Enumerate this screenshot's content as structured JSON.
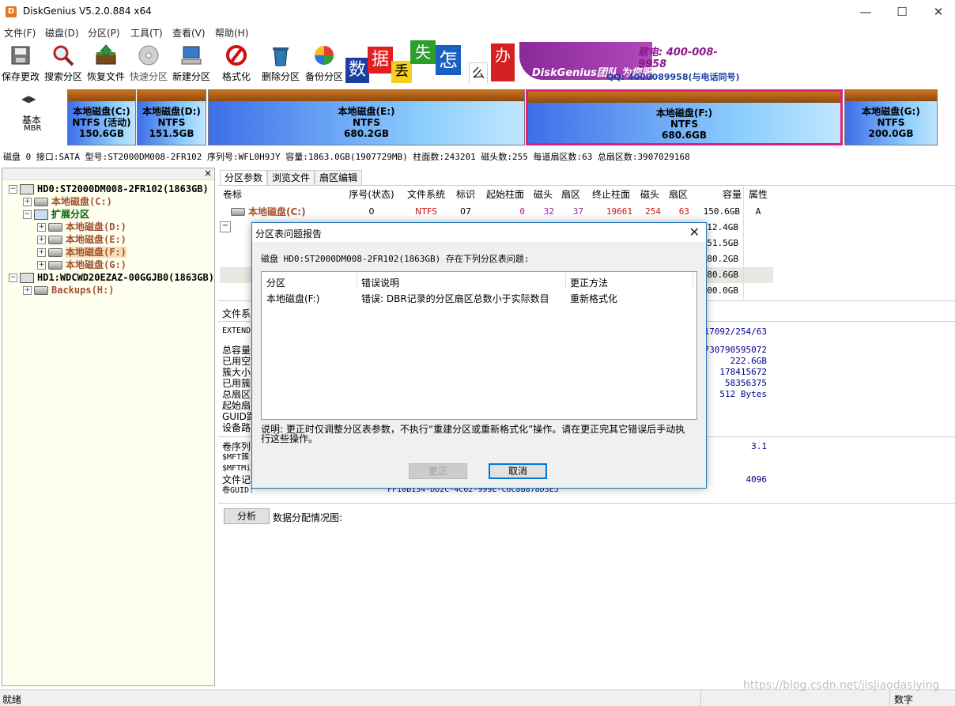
{
  "window": {
    "title": "DiskGenius V5.2.0.884 x64",
    "app_icon_letter": "D"
  },
  "menu": [
    "文件(F)",
    "磁盘(D)",
    "分区(P)",
    "工具(T)",
    "查看(V)",
    "帮助(H)"
  ],
  "toolbar": [
    {
      "label": "保存更改",
      "icon": "save-icon"
    },
    {
      "label": "搜索分区",
      "icon": "search-icon"
    },
    {
      "label": "恢复文件",
      "icon": "recover-file-icon"
    },
    {
      "label": "快速分区",
      "icon": "quick-partition-icon"
    },
    {
      "label": "新建分区",
      "icon": "new-partition-icon"
    },
    {
      "label": "格式化",
      "icon": "format-icon"
    },
    {
      "label": "删除分区",
      "icon": "delete-partition-icon"
    },
    {
      "label": "备份分区",
      "icon": "backup-partition-icon"
    }
  ],
  "banner": {
    "chars": [
      "数",
      "据",
      "丢",
      "失",
      "怎",
      "么",
      "办"
    ],
    "service": "DiskGenius团队 为您服务!",
    "phone": "致电: 400-008-9958",
    "qq": "QQ: 4000089958(与电话同号)"
  },
  "diskmap": {
    "label_top": "基本",
    "label_bottom": "MBR",
    "partitions": [
      {
        "name": "本地磁盘(C:)",
        "fs": "NTFS (活动)",
        "size": "150.6GB"
      },
      {
        "name": "本地磁盘(D:)",
        "fs": "NTFS",
        "size": "151.5GB"
      },
      {
        "name": "本地磁盘(E:)",
        "fs": "NTFS",
        "size": "680.2GB"
      },
      {
        "name": "本地磁盘(F:)",
        "fs": "NTFS",
        "size": "680.6GB"
      },
      {
        "name": "本地磁盘(G:)",
        "fs": "NTFS",
        "size": "200.0GB"
      }
    ]
  },
  "diskinfo": "磁盘 0 接口:SATA  型号:ST2000DM008-2FR102  序列号:WFL0H9JY  容量:1863.0GB(1907729MB)  柱面数:243201  磁头数:255  每道扇区数:63  总扇区数:3907029168",
  "tree": {
    "close": "×",
    "hd0": "HD0:ST2000DM008-2FR102(1863GB)",
    "c": "本地磁盘(C:)",
    "ext": "扩展分区",
    "d": "本地磁盘(D:)",
    "e": "本地磁盘(E:)",
    "f": "本地磁盘(F:)",
    "g": "本地磁盘(G:)",
    "hd1": "HD1:WDCWD20EZAZ-00GGJB0(1863GB)",
    "backups": "Backups(H:)"
  },
  "tabs": [
    "分区参数",
    "浏览文件",
    "扇区编辑"
  ],
  "table": {
    "headers": [
      "卷标",
      "序号(状态)",
      "文件系统",
      "标识",
      "起始柱面",
      "磁头",
      "扇区",
      "终止柱面",
      "磁头",
      "扇区",
      "容量",
      "属性"
    ],
    "row_c": {
      "name": "本地磁盘(C:)",
      "seq": "0",
      "fs": "NTFS",
      "id": "07",
      "start_cyl": "0",
      "start_head": "32",
      "start_sec": "37",
      "end_cyl": "19661",
      "end_head": "254",
      "end_sec": "63",
      "size": "150.6GB",
      "attr": "A"
    },
    "sizes": [
      "712.4GB",
      "151.5GB",
      "680.2GB",
      "680.6GB",
      "200.0GB"
    ]
  },
  "details": {
    "labels": [
      "文件系",
      "EXTEND",
      "总容量",
      "已用空",
      "簇大小",
      "已用簇",
      "总扇区",
      "起始扇",
      "GUID路",
      "设备路",
      "卷序列",
      "$MFT簇",
      "$MFTMi",
      "文件记",
      "卷GUID:"
    ],
    "values": [
      "217092/254/63",
      "730790595072",
      "222.6GB",
      "178415672",
      "58356375",
      "512 Bytes",
      "3.1",
      "4096"
    ],
    "volume_guid": "FF10B134-DD2C-4C62-999E-C6C8B878D3E5",
    "analyze_button": "分析",
    "alloc_label": "数据分配情况图:"
  },
  "dialog": {
    "title": "分区表问题报告",
    "message": "磁盘 HD0:ST2000DM008-2FR102(1863GB) 存在下列分区表问题:",
    "columns": [
      "分区",
      "错误说明",
      "更正方法"
    ],
    "rows": [
      {
        "partition": "本地磁盘(F:)",
        "error": "错误: DBR记录的分区扇区总数小于实际数目",
        "fix": "重新格式化"
      }
    ],
    "note_line1": "说明: 更正时仅调整分区表参数，不执行“重建分区或重新格式化”操作。请在更正完其它错误后手动执",
    "note_line2": "行这些操作。",
    "fix_button": "更正",
    "cancel_button": "取消"
  },
  "status": {
    "left": "就绪",
    "right": "数字",
    "watermark": "https://blog.csdn.net/jisjiaodasiying"
  }
}
